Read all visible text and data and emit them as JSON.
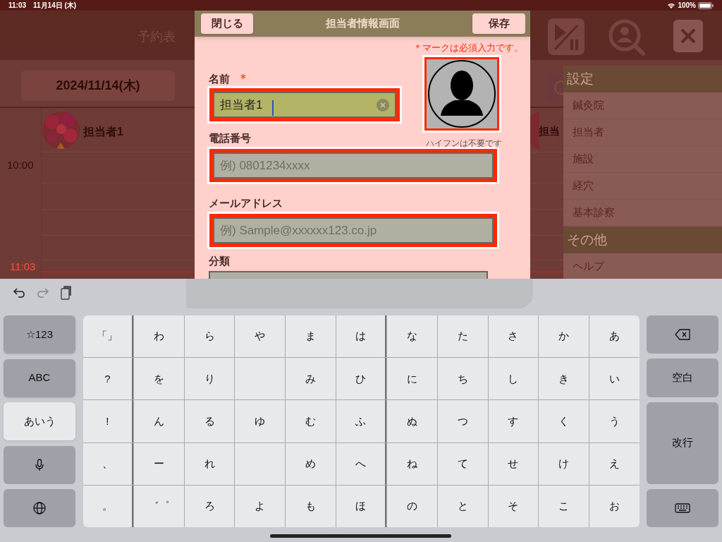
{
  "status_bar": {
    "time": "11:03",
    "date": "11月14日 (木)",
    "battery": "100%"
  },
  "background": {
    "title": "予約表",
    "date": "2024/11/14(木)",
    "staff": "担当者1",
    "staff_partial": "担当",
    "times": [
      "10:00",
      "11:03"
    ]
  },
  "modal": {
    "title": "担当者情報画面",
    "close_button": "閉じる",
    "save_button": "保存",
    "required_note": "＊マークは必須入力です。",
    "phone_hint": "ハイフンは不要です",
    "fields": [
      {
        "label": "名前",
        "mark": "＊",
        "value": "担当者1",
        "focused": true
      },
      {
        "label": "電話番号",
        "placeholder": "例) 0801234xxxx",
        "focused": false
      },
      {
        "label": "メールアドレス",
        "placeholder": "例) Sample@xxxxxx123.co.jp",
        "focused": false
      },
      {
        "label": "分類"
      }
    ]
  },
  "menu": {
    "sections": [
      {
        "title": "設定",
        "items": [
          "鍼灸院",
          "担当者",
          "施設",
          "経穴",
          "基本診察"
        ]
      },
      {
        "title": "その他",
        "items": [
          "ヘルプ"
        ]
      }
    ]
  },
  "keyboard": {
    "left_keys": [
      {
        "label": "☆123",
        "selected": false
      },
      {
        "label": "ABC",
        "selected": false
      },
      {
        "label": "あいう",
        "selected": true
      }
    ],
    "rows": [
      [
        "「」",
        "わ",
        "ら",
        "や",
        "ま",
        "は",
        "な",
        "た",
        "さ",
        "か",
        "あ"
      ],
      [
        "?",
        "を",
        "り",
        null,
        "み",
        "ひ",
        "に",
        "ち",
        "し",
        "き",
        "い"
      ],
      [
        "!",
        "ん",
        "る",
        "ゆ",
        "む",
        "ふ",
        "ぬ",
        "つ",
        "す",
        "く",
        "う"
      ],
      [
        "、",
        "ー",
        "れ",
        null,
        "め",
        "へ",
        "ね",
        "て",
        "せ",
        "け",
        "え"
      ],
      [
        "。",
        "゛゜",
        "ろ",
        "よ",
        "も",
        "ほ",
        "の",
        "と",
        "そ",
        "こ",
        "お"
      ]
    ],
    "space_key": "空白",
    "return_key": "改行"
  }
}
